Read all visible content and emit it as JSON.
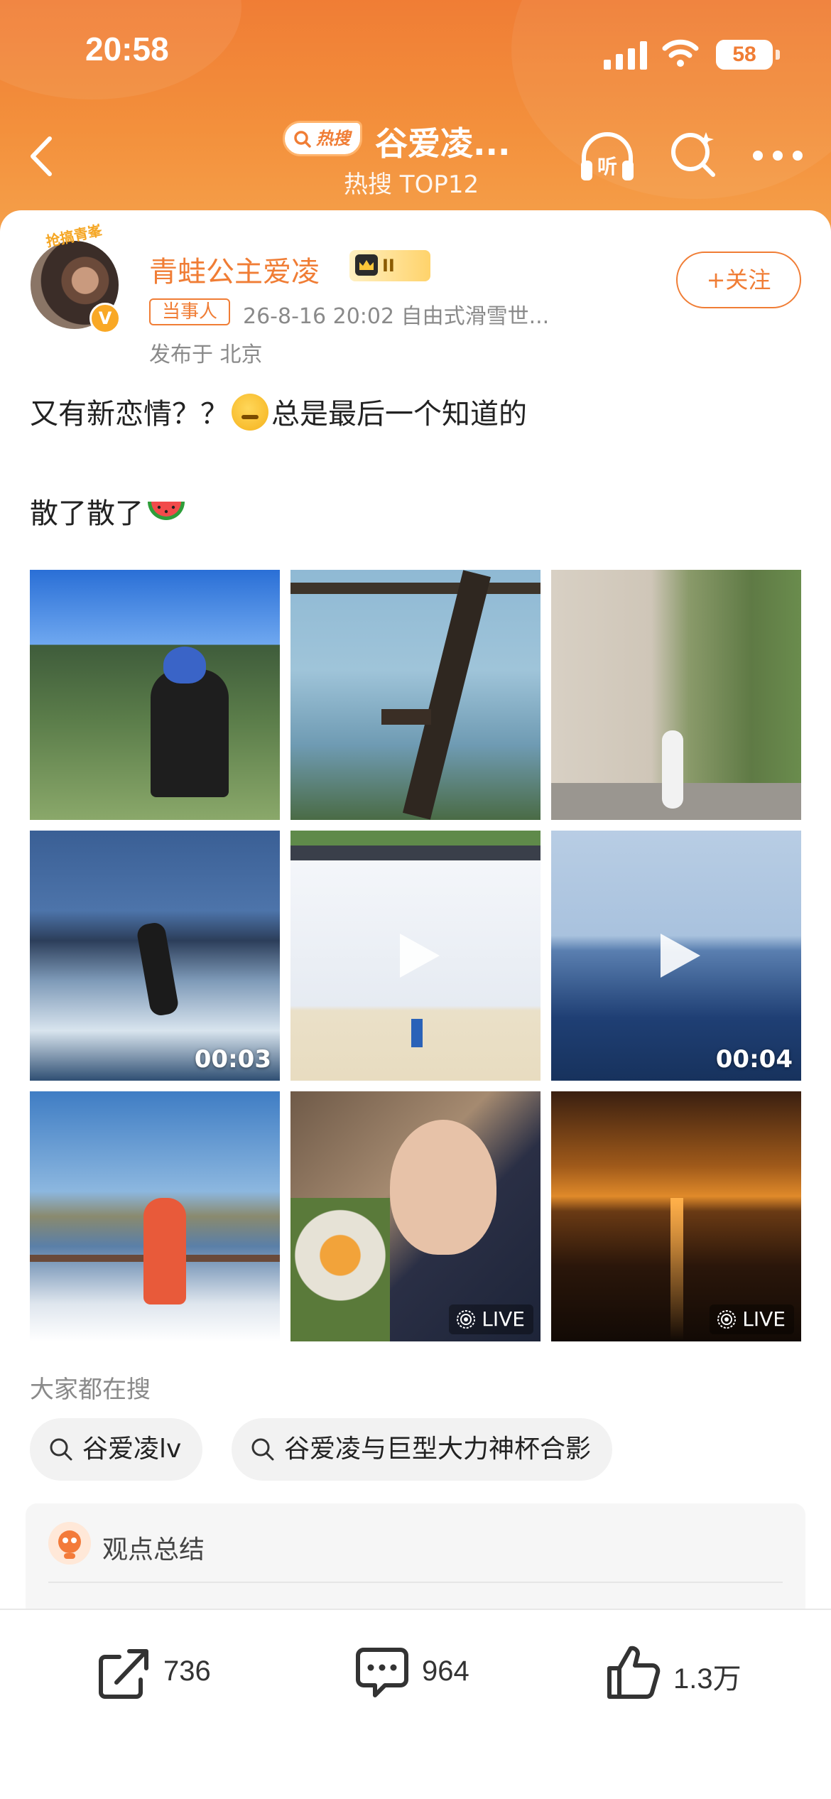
{
  "status_bar": {
    "time": "20:58",
    "battery": "58",
    "battery_level": 0.58
  },
  "header": {
    "hot_badge": "热搜",
    "title": "谷爱凌...",
    "subtitle": "热搜 TOP12"
  },
  "post": {
    "avatar_frame_text": "抢搞青峯",
    "user_name": "青蛙公主爱凌",
    "vip_level": "II",
    "follow_label": "+关注",
    "role_tag": "当事人",
    "meta": "26-8-16 20:02  自由式滑雪世...",
    "location": "发布于 北京",
    "text_line1_a": "又有新恋情？？",
    "text_line1_b": "总是最后一个知道的",
    "text_line2": "散了散了",
    "media": [
      {
        "type": "photo"
      },
      {
        "type": "photo"
      },
      {
        "type": "photo"
      },
      {
        "type": "video",
        "duration": "00:03"
      },
      {
        "type": "video"
      },
      {
        "type": "video",
        "duration": "00:04"
      },
      {
        "type": "photo"
      },
      {
        "type": "live",
        "badge": "LIVE"
      },
      {
        "type": "live",
        "badge": "LIVE"
      }
    ]
  },
  "search_suggestions": {
    "label": "大家都在搜",
    "items": [
      "谷爱凌lv",
      "谷爱凌与巨型大力神杯合影"
    ]
  },
  "summary": {
    "title": "观点总结"
  },
  "actions": {
    "repost_count": "736",
    "comment_count": "964",
    "like_count": "1.3万"
  },
  "colors": {
    "brand": "#f07d35",
    "muted": "#8a8a8a"
  }
}
